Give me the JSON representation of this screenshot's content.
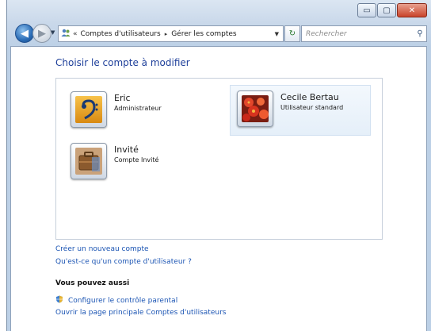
{
  "window": {
    "controls": {
      "minimize": "▭",
      "maximize": "▢",
      "close": "✕"
    }
  },
  "toolbar": {
    "back_icon": "arrow-left-icon",
    "forward_icon": "arrow-right-icon",
    "breadcrumb": {
      "chevron": "«",
      "items": [
        "Comptes d'utilisateurs",
        "Gérer les comptes"
      ],
      "separator": "▸"
    },
    "search_placeholder": "Rechercher"
  },
  "main": {
    "title": "Choisir le compte à modifier",
    "accounts": [
      {
        "name": "Eric",
        "type": "Administrateur",
        "selected": false
      },
      {
        "name": "Cecile Bertau",
        "type": "Utilisateur standard",
        "selected": true
      },
      {
        "name": "Invité",
        "type": "Compte Invité",
        "selected": false
      }
    ],
    "links": {
      "create_account": "Créer un nouveau compte",
      "what_is_account": "Qu'est-ce qu'un compte d'utilisateur ?"
    },
    "also": {
      "heading": "Vous pouvez aussi",
      "parental": "Configurer le contrôle parental",
      "main_page": "Ouvrir la page principale Comptes d'utilisateurs"
    }
  },
  "colors": {
    "link": "#1d56b4",
    "title": "#1e3f9a",
    "selection": "#e5eff9"
  }
}
